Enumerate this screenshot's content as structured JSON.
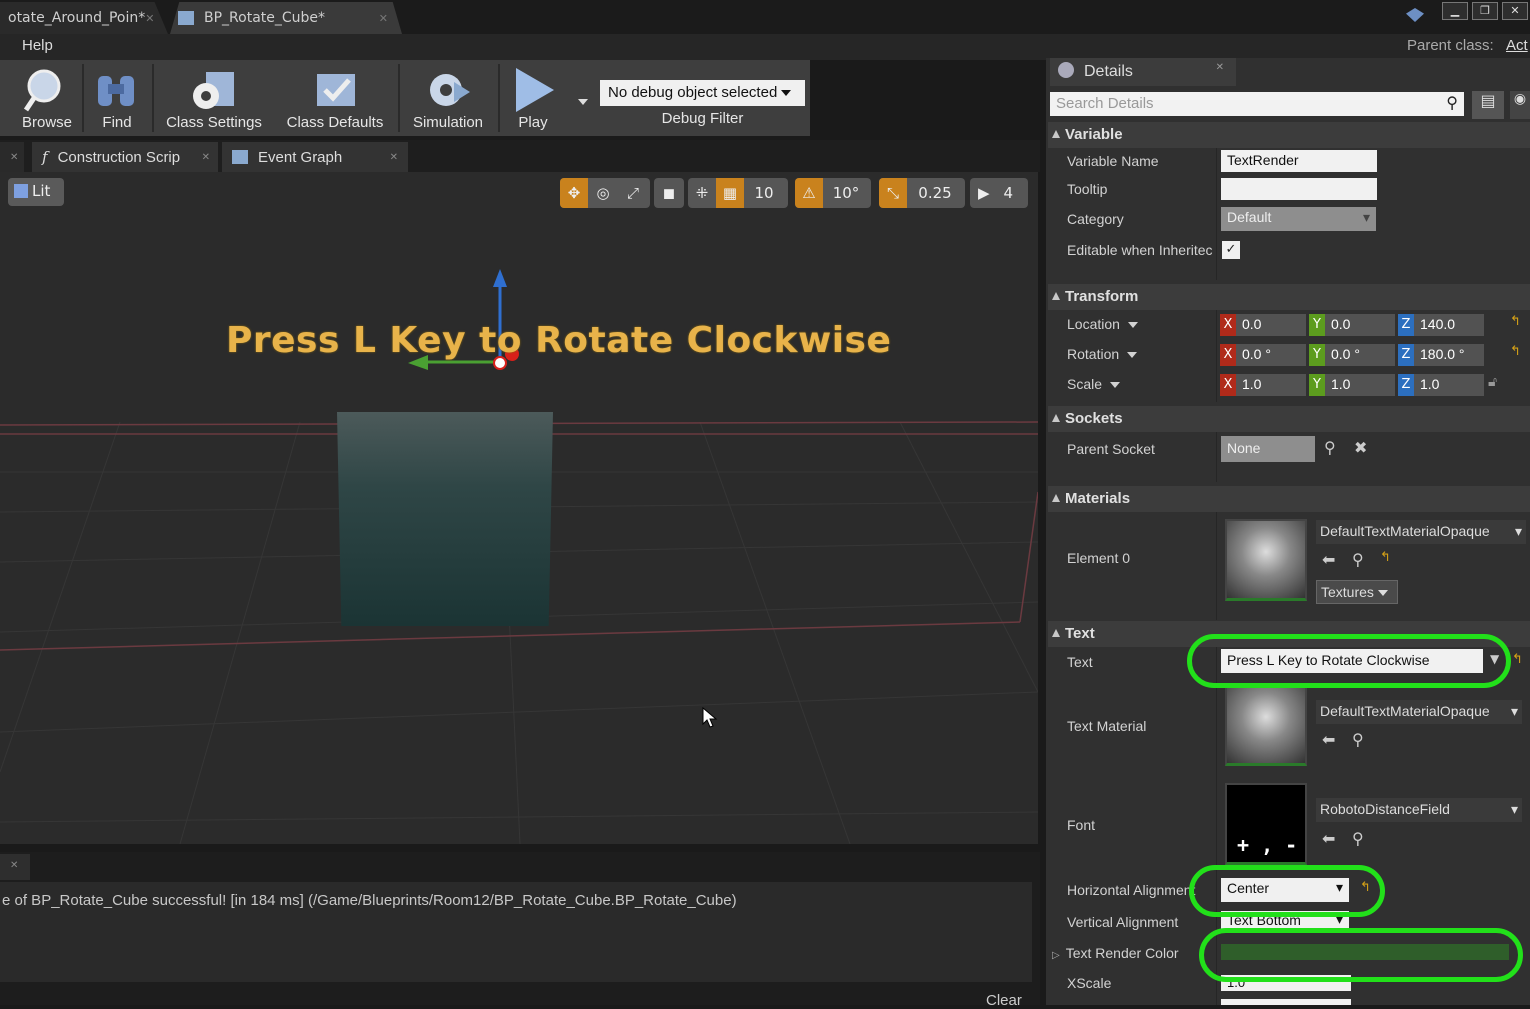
{
  "tabs": [
    {
      "label": "otate_Around_Poin*"
    },
    {
      "label": "BP_Rotate_Cube*"
    }
  ],
  "menu": {
    "help": "Help",
    "parent_class_label": "Parent class:",
    "parent_class_value": "Act"
  },
  "toolbar": {
    "browse": "Browse",
    "find": "Find",
    "class_settings": "Class Settings",
    "class_defaults": "Class Defaults",
    "simulation": "Simulation",
    "play": "Play",
    "debug_select": "No debug object selected",
    "debug_filter": "Debug Filter"
  },
  "graph_tabs": {
    "construction": "Construction Scrip",
    "event_graph": "Event Graph"
  },
  "viewport": {
    "lit": "Lit",
    "grid_snap": "10",
    "rot_snap": "10°",
    "scale_snap": "0.25",
    "cam_speed": "4",
    "text3d": "Press L Key to Rotate Clockwise"
  },
  "log": {
    "message": "e of BP_Rotate_Cube successful! [in 184 ms] (/Game/Blueprints/Room12/BP_Rotate_Cube.BP_Rotate_Cube)",
    "clear": "Clear"
  },
  "details": {
    "tab_label": "Details",
    "search_placeholder": "Search Details",
    "sections": {
      "variable": "Variable",
      "transform": "Transform",
      "sockets": "Sockets",
      "materials": "Materials",
      "text": "Text"
    },
    "variable": {
      "name_label": "Variable Name",
      "name_value": "TextRender",
      "tooltip_label": "Tooltip",
      "tooltip_value": "",
      "category_label": "Category",
      "category_value": "Default",
      "editable_label": "Editable when Inheritec"
    },
    "transform": {
      "location_label": "Location",
      "rotation_label": "Rotation",
      "scale_label": "Scale",
      "location": {
        "x": "0.0",
        "y": "0.0",
        "z": "140.0"
      },
      "rotation": {
        "x": "0.0 °",
        "y": "0.0 °",
        "z": "180.0 °"
      },
      "scale": {
        "x": "1.0",
        "y": "1.0",
        "z": "1.0"
      }
    },
    "sockets": {
      "parent_label": "Parent Socket",
      "parent_value": "None"
    },
    "materials": {
      "element0_label": "Element 0",
      "element0_value": "DefaultTextMaterialOpaque",
      "textures_btn": "Textures"
    },
    "text": {
      "text_label": "Text",
      "text_value": "Press L Key to Rotate Clockwise",
      "material_label": "Text Material",
      "material_value": "DefaultTextMaterialOpaque",
      "font_label": "Font",
      "font_value": "RobotoDistanceField",
      "font_preview": "+ , - . /",
      "halign_label": "Horizontal Alignment",
      "halign_value": "Center",
      "valign_label": "Vertical Alignment",
      "valign_value": "Text Bottom",
      "color_label": "Text Render Color",
      "xscale_label": "XScale",
      "xscale_value": "1.0"
    }
  },
  "colors": {
    "highlight": "#22e01a",
    "text_render_color": "#2f5e2a",
    "text3d": "#e8b34a"
  }
}
